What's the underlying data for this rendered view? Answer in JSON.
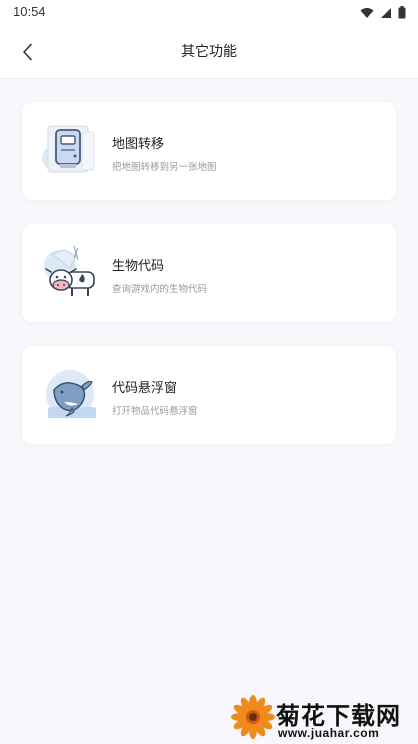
{
  "status_bar": {
    "time": "10:54",
    "icons": [
      "wifi-icon",
      "signal-icon",
      "battery-icon"
    ]
  },
  "nav": {
    "title": "其它功能",
    "back_icon": "chevron-left-icon"
  },
  "features": [
    {
      "title": "地图转移",
      "description": "把地图转移到另一张地图",
      "icon": "map-transfer-icon"
    },
    {
      "title": "生物代码",
      "description": "查询游戏内的生物代码",
      "icon": "cow-icon"
    },
    {
      "title": "代码悬浮窗",
      "description": "打开物品代码悬浮窗",
      "icon": "whale-icon"
    }
  ],
  "watermark": {
    "text": "菊花下载网",
    "url": "www.juahar.com"
  },
  "colors": {
    "background": "#f7f8fb",
    "card": "#ffffff",
    "accent_blue": "#6f9ed6",
    "watermark_orange": "#f08a1c"
  }
}
